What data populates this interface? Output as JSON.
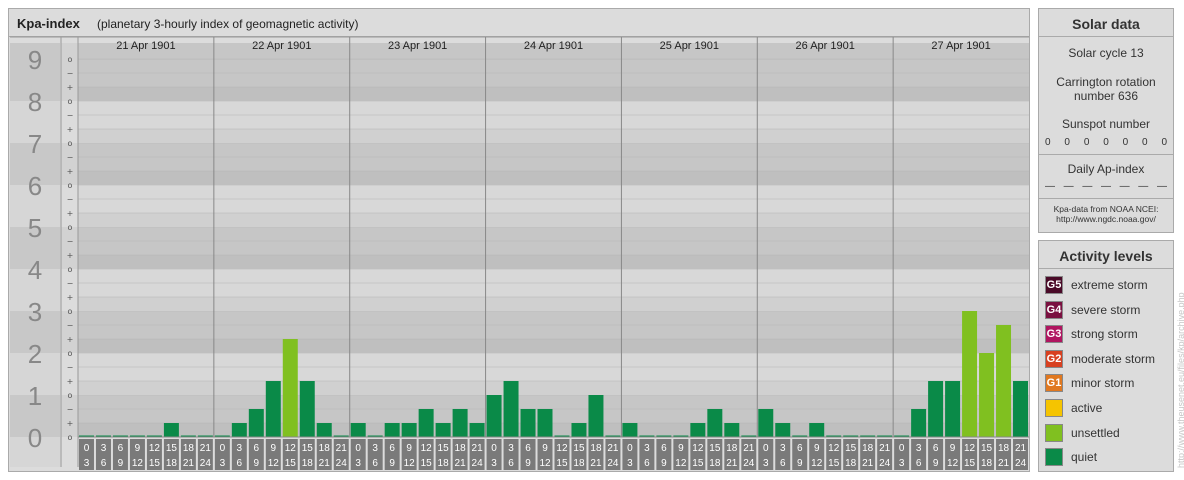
{
  "header": {
    "title": "Kpa-index",
    "subtitle": "(planetary 3-hourly index of geomagnetic activity)"
  },
  "chart_data": {
    "type": "bar",
    "title": "Kpa-index",
    "subtitle": "(planetary 3-hourly index of geomagnetic activity)",
    "ylim": [
      0,
      9
    ],
    "y_tick_labels": [
      "0",
      "1",
      "2",
      "3",
      "4",
      "5",
      "6",
      "7",
      "8",
      "9"
    ],
    "sub_tick_labels": [
      "+",
      "o",
      "−"
    ],
    "x_tick_labels_top": [
      "0",
      "3",
      "6",
      "9",
      "12",
      "15",
      "18",
      "21"
    ],
    "x_tick_labels_bottom": [
      "3",
      "6",
      "9",
      "12",
      "15",
      "18",
      "21",
      "24"
    ],
    "days": [
      "21 Apr 1901",
      "22 Apr 1901",
      "23 Apr 1901",
      "24 Apr 1901",
      "25 Apr 1901",
      "26 Apr 1901",
      "27 Apr 1901"
    ],
    "values": [
      [
        0,
        0,
        0,
        0,
        0,
        0.333,
        0,
        0
      ],
      [
        0,
        0.333,
        0.667,
        1.333,
        2.333,
        1.333,
        0.333,
        0
      ],
      [
        0.333,
        0,
        0.333,
        0.333,
        0.667,
        0.333,
        0.667,
        0.333
      ],
      [
        1,
        1.333,
        0.667,
        0.667,
        0,
        0.333,
        1,
        0
      ],
      [
        0.333,
        0,
        0,
        0,
        0.333,
        0.667,
        0.333,
        0
      ],
      [
        0.667,
        0.333,
        0,
        0.333,
        0,
        0,
        0,
        0
      ],
      [
        0,
        0.667,
        1.333,
        1.333,
        3,
        2,
        2.667,
        1.333
      ]
    ],
    "grid": true
  },
  "solar": {
    "title": "Solar data",
    "cycle": "Solar cycle 13",
    "carrington_line1": "Carrington rotation",
    "carrington_line2": "number 636",
    "sunspot_label": "Sunspot number",
    "sunspot_values": [
      "0",
      "0",
      "0",
      "0",
      "0",
      "0",
      "0"
    ],
    "ap_label": "Daily Ap-index",
    "ap_values": [
      "—",
      "—",
      "—",
      "—",
      "—",
      "—",
      "—"
    ],
    "source_line1": "Kpa-data from NOAA NCEI:",
    "source_line2": "http://www.ngdc.noaa.gov/"
  },
  "levels": {
    "title": "Activity levels",
    "items": [
      {
        "badge": "G5",
        "label": "extreme storm",
        "color": "#4a0a28"
      },
      {
        "badge": "G4",
        "label": "severe storm",
        "color": "#7a1040"
      },
      {
        "badge": "G3",
        "label": "strong storm",
        "color": "#b01560"
      },
      {
        "badge": "G2",
        "label": "moderate storm",
        "color": "#d84020"
      },
      {
        "badge": "G1",
        "label": "minor storm",
        "color": "#e07820"
      },
      {
        "badge": "",
        "label": "active",
        "color": "#f5c400"
      },
      {
        "badge": "",
        "label": "unsettled",
        "color": "#80c020"
      },
      {
        "badge": "",
        "label": "quiet",
        "color": "#0a8a48"
      }
    ]
  },
  "watermark": "http://www.theusenet.eu/files/kp/archive.php"
}
